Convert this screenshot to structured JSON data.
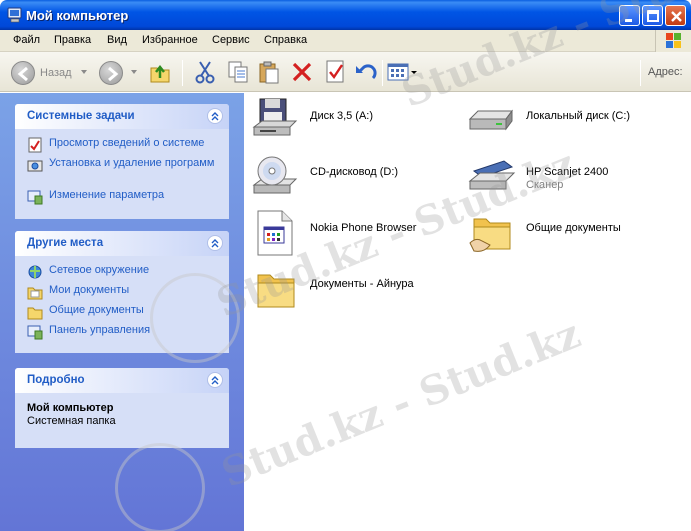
{
  "window": {
    "title": "Мой компьютер"
  },
  "menu": [
    "Файл",
    "Правка",
    "Вид",
    "Избранное",
    "Сервис",
    "Справка"
  ],
  "toolbar": {
    "back_label": "Назад",
    "address_label": "Адрес:"
  },
  "system_tasks": {
    "title": "Системные задачи",
    "items": [
      {
        "label": "Просмотр сведений о системе",
        "icon": "system-info-icon"
      },
      {
        "label": "Установка и удаление программ",
        "icon": "add-remove-programs-icon"
      },
      {
        "label": "Изменение параметра",
        "icon": "control-panel-icon"
      }
    ]
  },
  "other_places": {
    "title": "Другие места",
    "items": [
      {
        "label": "Сетевое окружение",
        "icon": "network-icon"
      },
      {
        "label": "Мои документы",
        "icon": "my-documents-icon"
      },
      {
        "label": "Общие документы",
        "icon": "shared-folder-icon"
      },
      {
        "label": "Панель управления",
        "icon": "control-panel-icon"
      }
    ]
  },
  "details": {
    "title": "Подробно",
    "name": "Мой компьютер",
    "type": "Системная папка"
  },
  "items": [
    {
      "label": "Диск 3,5 (A:)",
      "sub": "",
      "icon": "floppy-drive-icon"
    },
    {
      "label": "Локальный диск (C:)",
      "sub": "",
      "icon": "hard-drive-icon"
    },
    {
      "label": "CD-дисковод (D:)",
      "sub": "",
      "icon": "cd-drive-icon"
    },
    {
      "label": "HP Scanjet 2400",
      "sub": "Сканер",
      "icon": "scanner-icon"
    },
    {
      "label": "Nokia Phone Browser",
      "sub": "",
      "icon": "phone-browser-icon"
    },
    {
      "label": "Общие документы",
      "sub": "",
      "icon": "shared-folder-icon"
    },
    {
      "label": "Документы - Айнура",
      "sub": "",
      "icon": "folder-icon"
    }
  ],
  "watermark": "Stud.kz - Stud.kz"
}
